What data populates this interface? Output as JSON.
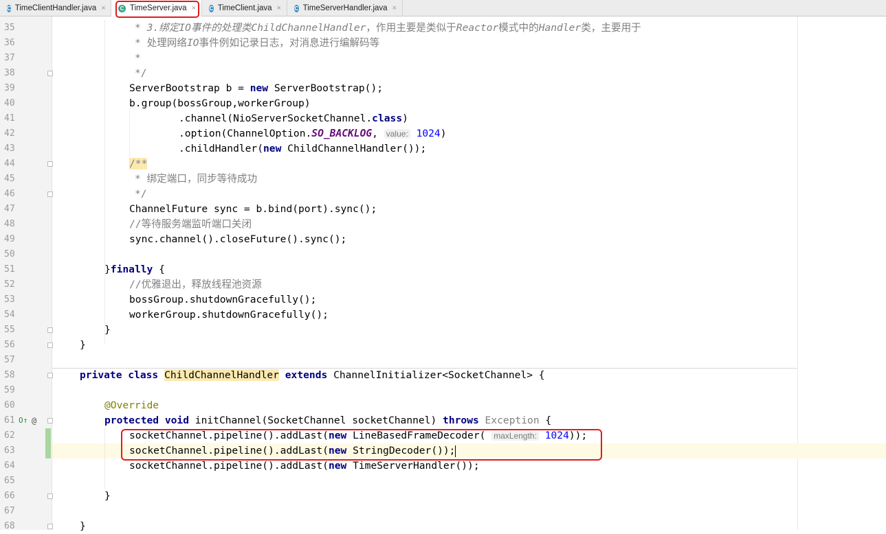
{
  "tabs": [
    {
      "label": "TimeClientHandler.java",
      "icon": "c-class-icon",
      "active": false
    },
    {
      "label": "TimeServer.java",
      "icon": "c-class-icon",
      "active": true
    },
    {
      "label": "TimeClient.java",
      "icon": "c-class-icon",
      "active": false
    },
    {
      "label": "TimeServerHandler.java",
      "icon": "c-class-icon",
      "active": false
    }
  ],
  "tab_icon_letter": "C",
  "tab_close": "×",
  "line_numbers": [
    "35",
    "36",
    "37",
    "38",
    "39",
    "40",
    "41",
    "42",
    "43",
    "44",
    "45",
    "46",
    "47",
    "48",
    "49",
    "50",
    "51",
    "52",
    "53",
    "54",
    "55",
    "56",
    "57",
    "58",
    "59",
    "60",
    "61",
    "62",
    "63",
    "64",
    "65",
    "66",
    "67",
    "68"
  ],
  "gutter_markers": {
    "override_arrow": "O↑",
    "at_sign": "@"
  },
  "code": {
    "l35_a": "* ",
    "l35_b": "3.绑定IO事件的处理类ChildChannelHandler",
    "l35_c": "，作用主要是类似于",
    "l35_d": "Reactor",
    "l35_e": "模式中的",
    "l35_f": "Handler",
    "l35_g": "类，主要用于",
    "l36_a": "* 处理网络",
    "l36_b": "IO",
    "l36_c": "事件例如记录日志，对消息进行编解码等",
    "l37": "*",
    "l38": "*/",
    "l39_a": "ServerBootstrap b = ",
    "l39_kw": "new",
    "l39_b": " ServerBootstrap();",
    "l40": "b.group(bossGroup,workerGroup)",
    "l41_a": ".channel(NioServerSocketChannel.",
    "l41_kw": "class",
    "l41_b": ")",
    "l42_a": ".option(ChannelOption.",
    "l42_sf": "SO_BACKLOG",
    "l42_b": ", ",
    "l42_hint": "value:",
    "l42_num": "1024",
    "l42_c": ")",
    "l43_a": ".childHandler(",
    "l43_kw": "new",
    "l43_b": " ChildChannelHandler());",
    "l44": "/**",
    "l45": "* 绑定端口，同步等待成功",
    "l46": "*/",
    "l47": "ChannelFuture sync = b.bind(port).sync();",
    "l48": "//等待服务端监听端口关闭",
    "l49": "sync.channel().closeFuture().sync();",
    "l51_a": "}",
    "l51_kw": "finally",
    "l51_b": " {",
    "l52": "//优雅退出，释放线程池资源",
    "l53": "bossGroup.shutdownGracefully();",
    "l54": "workerGroup.shutdownGracefully();",
    "l55": "}",
    "l56": "}",
    "l58_kw1": "private class",
    "l58_name": "ChildChannelHandler",
    "l58_kw2": "extends",
    "l58_b": " ChannelInitializer<SocketChannel> {",
    "l60": "@Override",
    "l61_kw": "protected void",
    "l61_a": " initChannel(SocketChannel socketChannel) ",
    "l61_kw2": "throws",
    "l61_exc": " Exception",
    "l61_b": " {",
    "l62_a": "socketChannel.pipeline().addLast(",
    "l62_kw": "new",
    "l62_b": " LineBasedFrameDecoder(",
    "l62_hint": "maxLength:",
    "l62_num": "1024",
    "l62_c": "));",
    "l63_a": "socketChannel.pipeline().addLast(",
    "l63_kw": "new",
    "l63_b": " StringDecoder());",
    "l64_a": "socketChannel.pipeline().addLast(",
    "l64_kw": "new",
    "l64_b": " TimeServerHandler());",
    "l66": "}",
    "l68": "}"
  },
  "colors": {
    "highlight_box": "#e01b1b",
    "keyword": "#000080",
    "comment": "#808080",
    "number": "#0000ff",
    "annotation": "#808000",
    "static_field": "#660e7a"
  }
}
